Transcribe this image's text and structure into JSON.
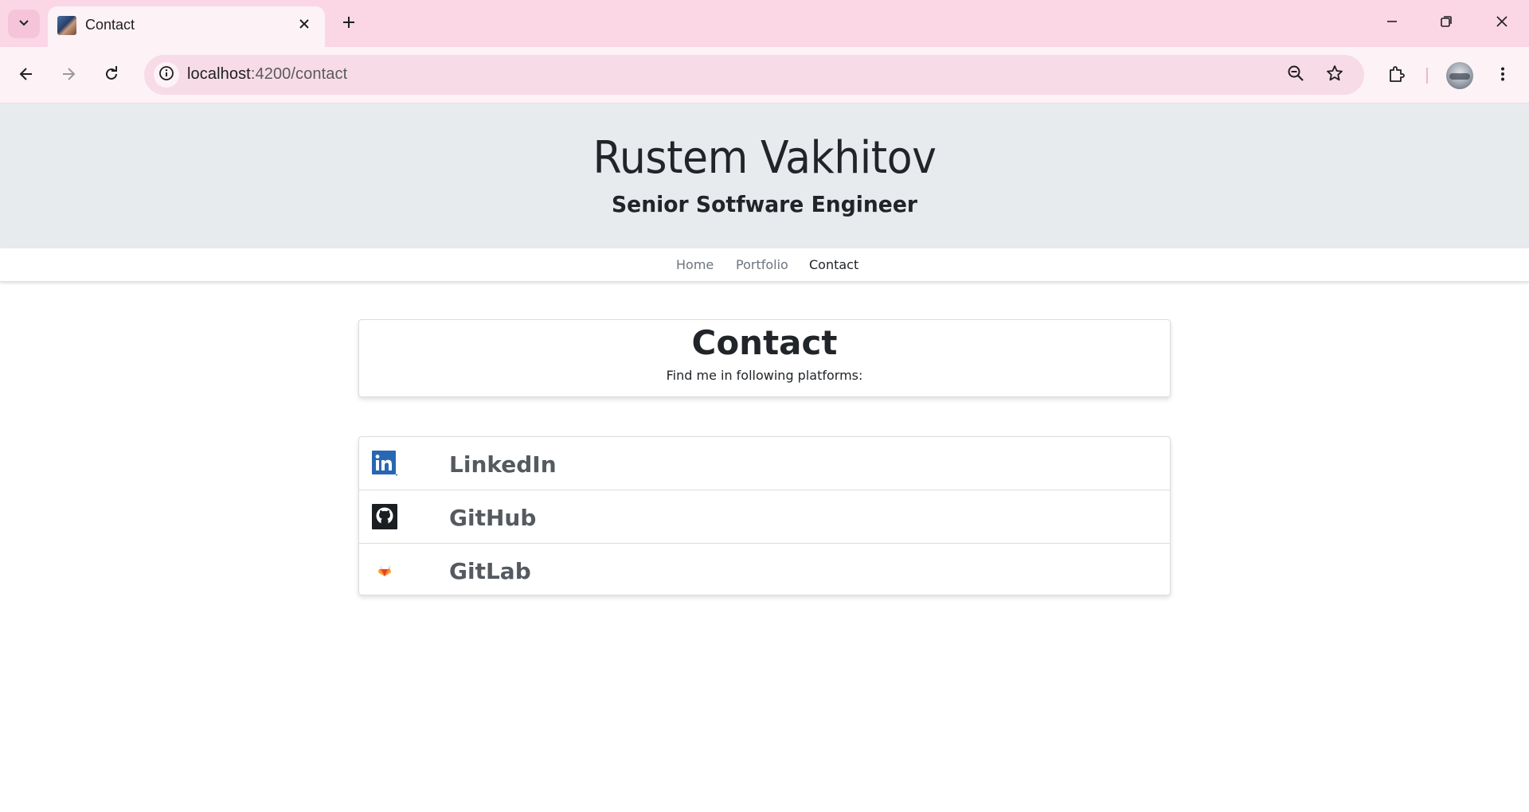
{
  "browser": {
    "tab_title": "Contact",
    "url_host": "localhost",
    "url_path": ":4200/contact"
  },
  "header": {
    "name": "Rustem Vakhitov",
    "role": "Senior Sotfware Engineer"
  },
  "nav": {
    "items": [
      {
        "label": "Home",
        "active": false
      },
      {
        "label": "Portfolio",
        "active": false
      },
      {
        "label": "Contact",
        "active": true
      }
    ]
  },
  "contact": {
    "title": "Contact",
    "subtitle": "Find me in following platforms:"
  },
  "links": [
    {
      "label": "LinkedIn",
      "icon": "linkedin-icon"
    },
    {
      "label": "GitHub",
      "icon": "github-icon"
    },
    {
      "label": "GitLab",
      "icon": "gitlab-icon"
    }
  ],
  "colors": {
    "chrome_tabstrip": "#fbd6e5",
    "chrome_toolbar": "#fdf2f6",
    "hero_bg": "#e8ebee",
    "linkedin": "#2867b2",
    "github": "#1b1f23",
    "gitlab": "#e24329"
  }
}
